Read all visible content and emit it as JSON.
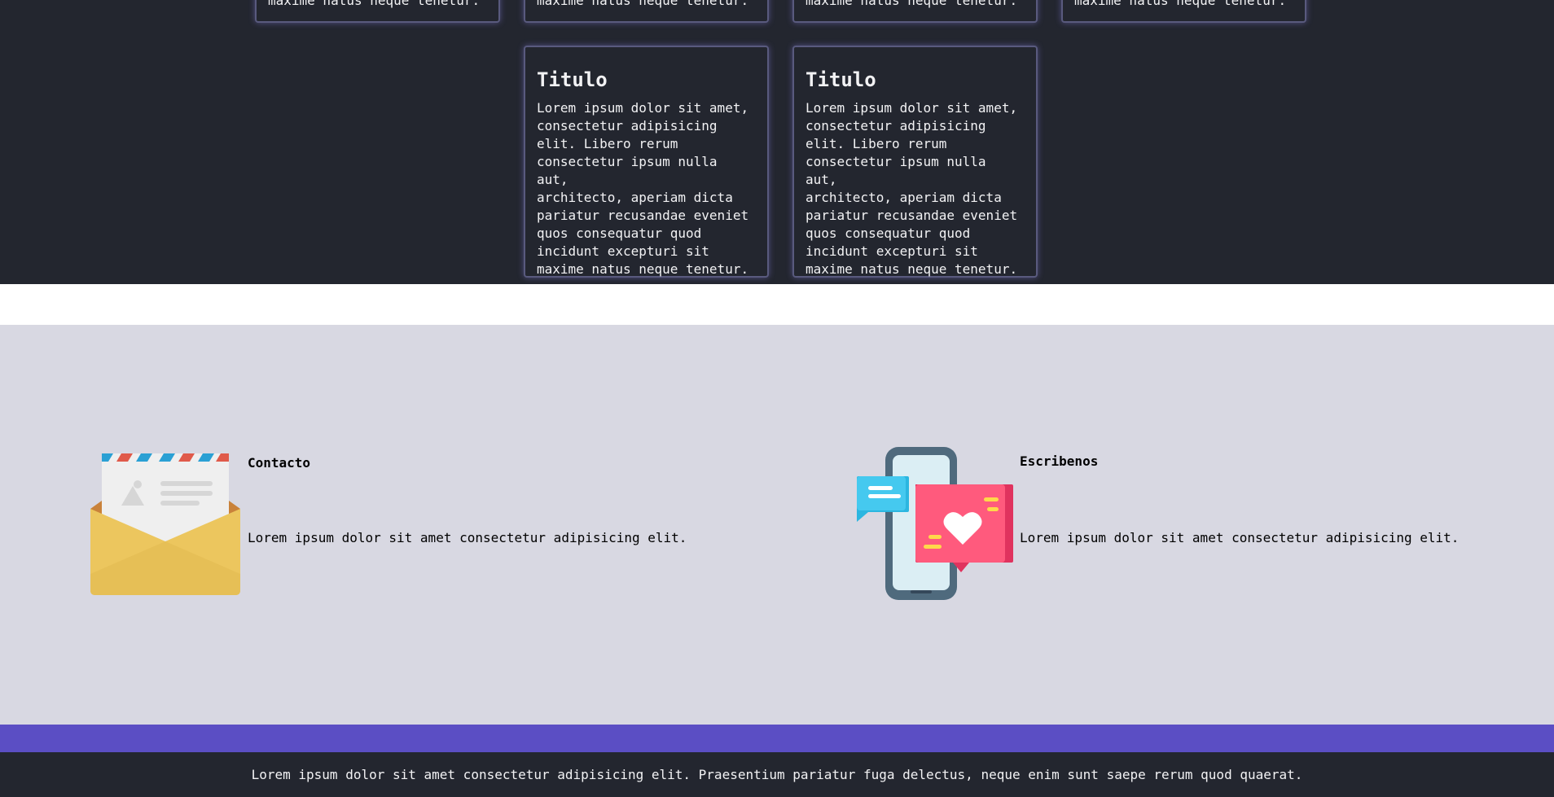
{
  "cards_top_row": [
    {
      "text": "maxime natus neque tenetur."
    },
    {
      "text": "maxime natus neque tenetur."
    },
    {
      "text": "maxime natus neque tenetur."
    },
    {
      "text": "maxime natus neque tenetur."
    }
  ],
  "cards": [
    {
      "title": "Titulo",
      "body": "Lorem ipsum dolor sit amet,\nconsectetur adipisicing\nelit. Libero rerum\nconsectetur ipsum nulla aut,\narchitecto, aperiam dicta\npariatur recusandae eveniet\nquos consequatur quod\nincidunt excepturi sit\nmaxime natus neque tenetur."
    },
    {
      "title": "Titulo",
      "body": "Lorem ipsum dolor sit amet,\nconsectetur adipisicing\nelit. Libero rerum\nconsectetur ipsum nulla aut,\narchitecto, aperiam dicta\npariatur recusandae eveniet\nquos consequatur quod\nincidunt excepturi sit\nmaxime natus neque tenetur."
    }
  ],
  "contact": {
    "left": {
      "title": "Contacto",
      "text": "Lorem ipsum dolor sit amet consectetur adipisicing elit.",
      "icon": "envelope-icon"
    },
    "right": {
      "title": "Escribenos",
      "text": "Lorem ipsum dolor sit amet consectetur adipisicing elit.",
      "icon": "phone-chat-icon"
    }
  },
  "footer": {
    "text": "Lorem ipsum dolor sit amet consectetur adipisicing elit. Praesentium pariatur fuga delectus, neque enim sunt saepe rerum quod quaerat."
  },
  "colors": {
    "dark_bg": "#23262f",
    "contact_bg": "#d8d8e2",
    "accent": "#5b4ec4"
  }
}
